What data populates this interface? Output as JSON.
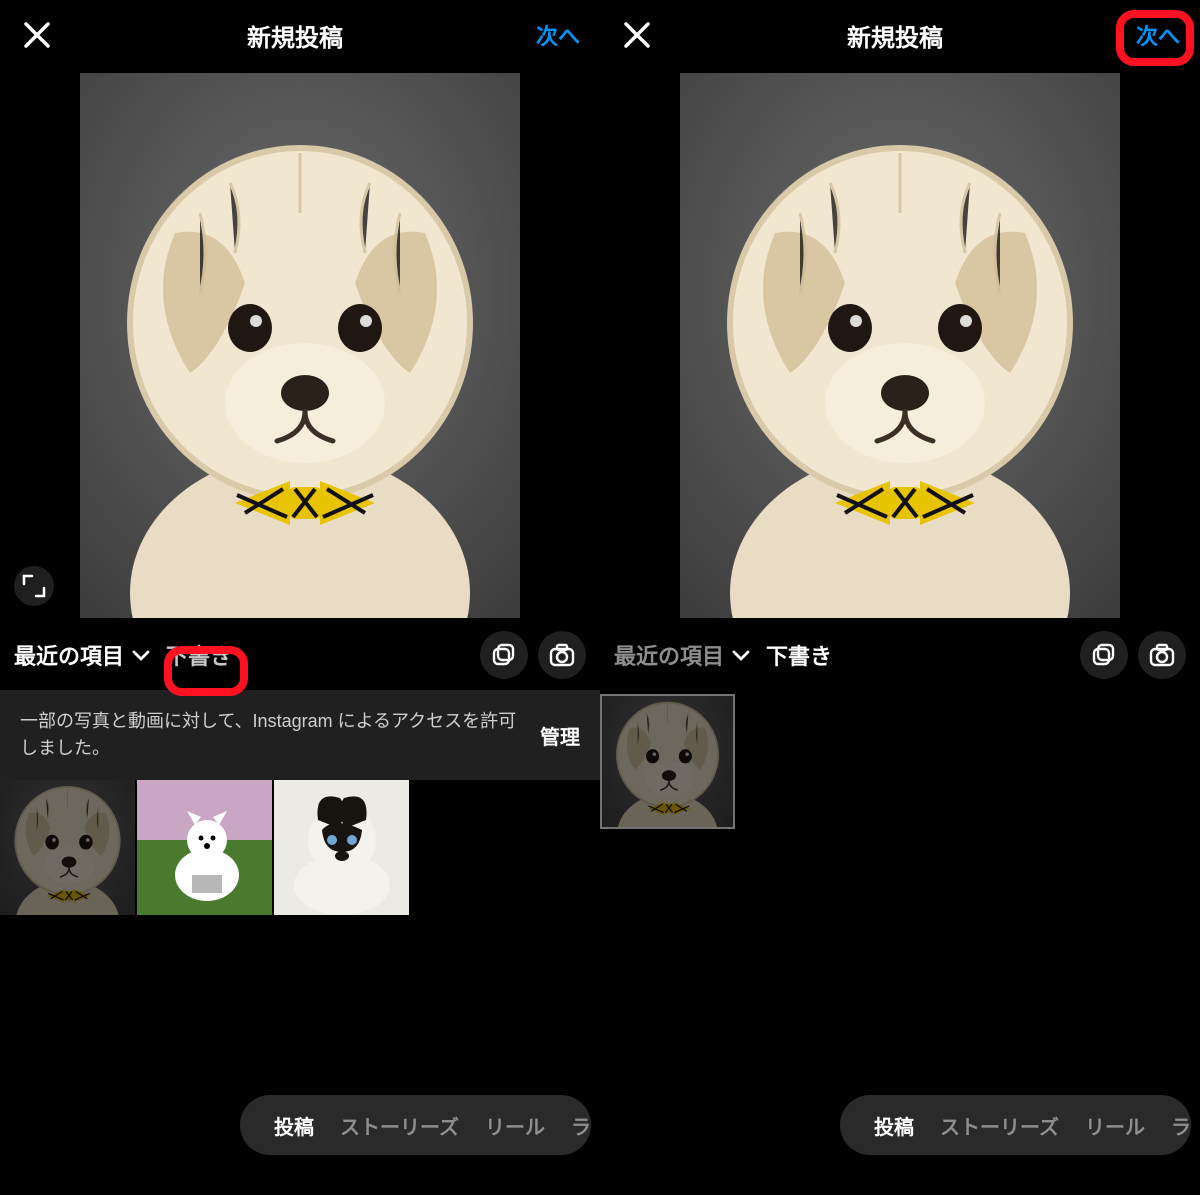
{
  "colors": {
    "accent": "#0095f6",
    "highlight": "#ff1122"
  },
  "left": {
    "header": {
      "title": "新規投稿",
      "next": "次へ"
    },
    "source": {
      "recents": "最近の項目",
      "drafts": "下書き"
    },
    "permission": {
      "message": "一部の写真と動画に対して、Instagram によるアクセスを許可しました。",
      "manage": "管理"
    },
    "nav": {
      "post": "投稿",
      "stories": "ストーリーズ",
      "reel": "リール",
      "live": "ラ"
    }
  },
  "right": {
    "header": {
      "title": "新規投稿",
      "next": "次へ"
    },
    "source": {
      "recents": "最近の項目",
      "drafts": "下書き"
    },
    "nav": {
      "post": "投稿",
      "stories": "ストーリーズ",
      "reel": "リール",
      "live": "ラ"
    }
  }
}
